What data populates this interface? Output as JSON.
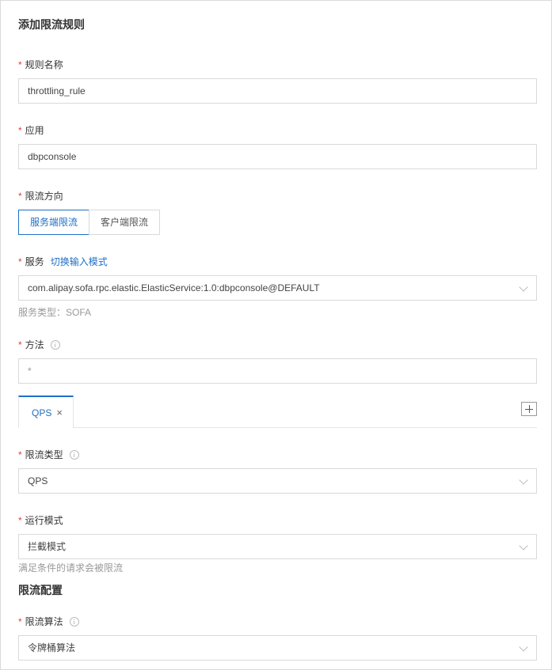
{
  "title": "添加限流规则",
  "fields": {
    "rule_name": {
      "label": "规则名称",
      "value": "throttling_rule"
    },
    "app": {
      "label": "应用",
      "value": "dbpconsole"
    },
    "direction": {
      "label": "限流方向",
      "options": [
        "服务端限流",
        "客户端限流"
      ],
      "selected": "服务端限流"
    },
    "service": {
      "label": "服务",
      "toggle_link": "切换输入模式",
      "value": "com.alipay.sofa.rpc.elastic.ElasticService:1.0:dbpconsole@DEFAULT",
      "help": "服务类型：SOFA"
    },
    "method": {
      "label": "方法",
      "value": "*"
    }
  },
  "tabs": [
    {
      "label": "QPS",
      "close": "×"
    }
  ],
  "tab_content": {
    "limit_type": {
      "label": "限流类型",
      "value": "QPS"
    },
    "run_mode": {
      "label": "运行模式",
      "value": "拦截模式",
      "help": "满足条件的请求会被限流"
    },
    "config_section": "限流配置",
    "algorithm": {
      "label": "限流算法",
      "value": "令牌桶算法"
    }
  },
  "required_mark": "*",
  "colors": {
    "accent": "#1e6fc7",
    "required": "#e23d3d"
  }
}
